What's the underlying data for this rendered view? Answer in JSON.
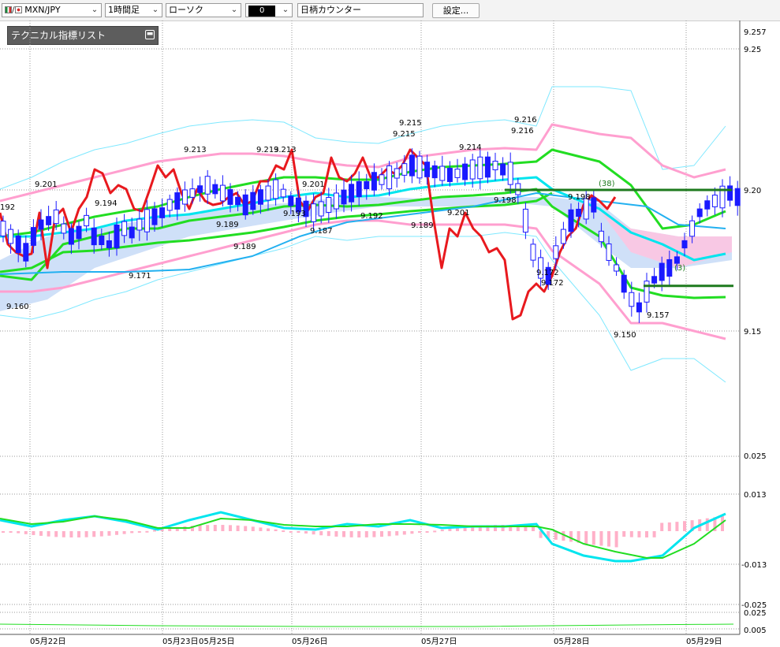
{
  "toolbar": {
    "symbol": "MXN/JPY",
    "timeframe": "1時間足",
    "chart_style": "ローソク",
    "draw_tool": "0",
    "counter_input_value": "日柄カウンター",
    "settings_button": "設定..."
  },
  "indicator_panel": {
    "title": "テクニカル指標リスト",
    "toggle_icon": "minimize-icon"
  },
  "colors": {
    "up_candle": "#ffffff",
    "down_candle": "#1a1aff",
    "rsi_line": "#e8191e",
    "bollinger_outer": "#7ee8ff",
    "bollinger_inner": "#ff9fcf",
    "moving_average": "#22dd22",
    "cloud_blue": "#cfe0f8",
    "cloud_pink": "#f8c8e4",
    "horizontal_line": "#1e7a1e"
  },
  "price_axis": {
    "labels": [
      "9.257",
      "9.25",
      "9.20",
      "9.15"
    ]
  },
  "oscillator_axis": {
    "labels": [
      "0.025",
      "0.013",
      "-0.013",
      "-0.025",
      "0.025",
      "0.005"
    ]
  },
  "time_axis": {
    "labels": [
      "05月22日",
      "05月23日",
      "05月25日",
      "05月26日",
      "05月27日",
      "05月28日",
      "05月29日"
    ]
  },
  "chart_annotations": {
    "price_labels": [
      "192",
      "9.201",
      "9.194",
      "9.160",
      "9.171",
      "9.213",
      "9.189",
      "9.189",
      "9.213",
      "9.213",
      "9.201",
      "9.193",
      "9.187",
      "9.192",
      "9.215",
      "9.215",
      "9.189",
      "9.201",
      "9.214",
      "9.216",
      "9.216",
      "9.198",
      "9.172",
      "9.172",
      "9.198",
      "9.150",
      "9.157"
    ],
    "count_labels": [
      "(38)",
      "(3)"
    ]
  },
  "chart_data": {
    "type": "candlestick",
    "title": "",
    "xlabel": "",
    "ylabel": "",
    "ylim": [
      9.135,
      9.262
    ],
    "grid": true,
    "categories": [
      "05月22日",
      "05月23日",
      "05月25日",
      "05月26日",
      "05月27日",
      "05月28日",
      "05月29日"
    ],
    "marked_prices": {
      "highs": [
        9.201,
        9.213,
        9.213,
        9.213,
        9.215,
        9.215,
        9.214,
        9.216,
        9.216,
        9.198
      ],
      "lows": [
        9.16,
        9.171,
        9.189,
        9.189,
        9.187,
        9.193,
        9.192,
        9.189,
        9.172,
        9.172,
        9.15,
        9.157
      ],
      "other": [
        9.192,
        9.194,
        9.201,
        9.201,
        9.198
      ]
    },
    "horizontal_lines": [
      9.2,
      9.166
    ],
    "sub_panels": [
      {
        "name": "oscillator",
        "levels": [
          0.025,
          0.013,
          -0.013,
          -0.025
        ]
      },
      {
        "name": "lower",
        "levels": [
          0.025,
          0.005
        ]
      }
    ]
  }
}
